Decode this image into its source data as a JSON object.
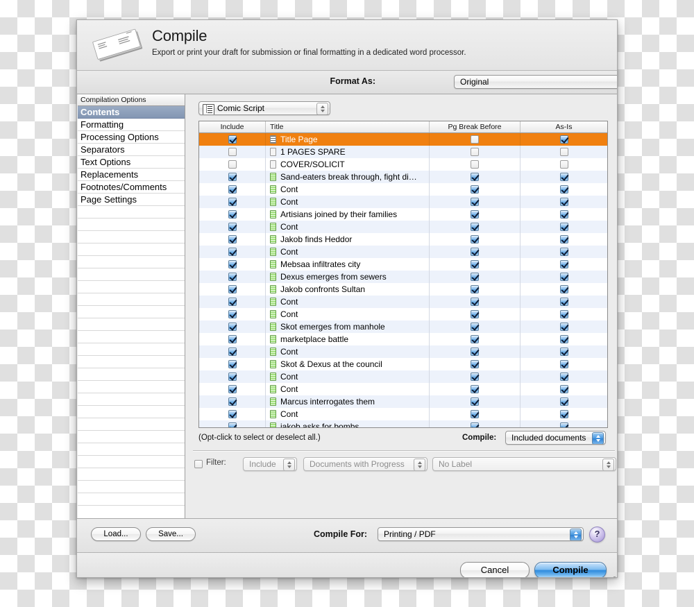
{
  "header": {
    "title": "Compile",
    "subtitle": "Export or print your draft for submission or final formatting in a dedicated word processor.",
    "icon": "manuscript-icon"
  },
  "format_bar": {
    "label": "Format As:",
    "value": "Original",
    "reveal_icon": "triangle-up-icon"
  },
  "sidebar": {
    "header": "Compilation Options",
    "items": [
      {
        "label": "Contents",
        "selected": true
      },
      {
        "label": "Formatting",
        "selected": false
      },
      {
        "label": "Processing Options",
        "selected": false
      },
      {
        "label": "Separators",
        "selected": false
      },
      {
        "label": "Text Options",
        "selected": false
      },
      {
        "label": "Replacements",
        "selected": false
      },
      {
        "label": "Footnotes/Comments",
        "selected": false
      },
      {
        "label": "Page Settings",
        "selected": false
      }
    ]
  },
  "script_popup": {
    "value": "Comic Script",
    "icon": "script-document-icon"
  },
  "table": {
    "columns": [
      "Include",
      "Title",
      "Pg Break Before",
      "As-Is"
    ],
    "rows": [
      {
        "include": true,
        "title": "Title Page",
        "icon": "title-page-icon",
        "pg_break": false,
        "as_is": true,
        "selected": true
      },
      {
        "include": false,
        "title": "1 PAGES SPARE",
        "icon": "plain-document-icon",
        "pg_break": false,
        "as_is": false,
        "selected": false
      },
      {
        "include": false,
        "title": "COVER/SOLICIT",
        "icon": "plain-document-icon",
        "pg_break": false,
        "as_is": false,
        "selected": false
      },
      {
        "include": true,
        "title": "Sand-eaters break through, fight di…",
        "icon": "text-document-icon",
        "pg_break": true,
        "as_is": true,
        "selected": false
      },
      {
        "include": true,
        "title": "Cont",
        "icon": "text-document-icon",
        "pg_break": true,
        "as_is": true,
        "selected": false
      },
      {
        "include": true,
        "title": "Cont",
        "icon": "text-document-icon",
        "pg_break": true,
        "as_is": true,
        "selected": false
      },
      {
        "include": true,
        "title": "Artisians joined by their families",
        "icon": "text-document-icon",
        "pg_break": true,
        "as_is": true,
        "selected": false
      },
      {
        "include": true,
        "title": "Cont",
        "icon": "text-document-icon",
        "pg_break": true,
        "as_is": true,
        "selected": false
      },
      {
        "include": true,
        "title": "Jakob finds Heddor",
        "icon": "text-document-icon",
        "pg_break": true,
        "as_is": true,
        "selected": false
      },
      {
        "include": true,
        "title": "Cont",
        "icon": "text-document-icon",
        "pg_break": true,
        "as_is": true,
        "selected": false
      },
      {
        "include": true,
        "title": "Mebsaa infiltrates city",
        "icon": "text-document-icon",
        "pg_break": true,
        "as_is": true,
        "selected": false
      },
      {
        "include": true,
        "title": "Dexus emerges from sewers",
        "icon": "text-document-icon",
        "pg_break": true,
        "as_is": true,
        "selected": false
      },
      {
        "include": true,
        "title": "Jakob confronts Sultan",
        "icon": "text-document-icon",
        "pg_break": true,
        "as_is": true,
        "selected": false
      },
      {
        "include": true,
        "title": "Cont",
        "icon": "text-document-icon",
        "pg_break": true,
        "as_is": true,
        "selected": false
      },
      {
        "include": true,
        "title": "Cont",
        "icon": "text-document-icon",
        "pg_break": true,
        "as_is": true,
        "selected": false
      },
      {
        "include": true,
        "title": "Skot emerges from manhole",
        "icon": "text-document-icon",
        "pg_break": true,
        "as_is": true,
        "selected": false
      },
      {
        "include": true,
        "title": "marketplace battle",
        "icon": "text-document-icon",
        "pg_break": true,
        "as_is": true,
        "selected": false
      },
      {
        "include": true,
        "title": "Cont",
        "icon": "text-document-icon",
        "pg_break": true,
        "as_is": true,
        "selected": false
      },
      {
        "include": true,
        "title": "Skot & Dexus at the council",
        "icon": "text-document-icon",
        "pg_break": true,
        "as_is": true,
        "selected": false
      },
      {
        "include": true,
        "title": "Cont",
        "icon": "text-document-icon",
        "pg_break": true,
        "as_is": true,
        "selected": false
      },
      {
        "include": true,
        "title": "Cont",
        "icon": "text-document-icon",
        "pg_break": true,
        "as_is": true,
        "selected": false
      },
      {
        "include": true,
        "title": "Marcus interrogates them",
        "icon": "text-document-icon",
        "pg_break": true,
        "as_is": true,
        "selected": false
      },
      {
        "include": true,
        "title": "Cont",
        "icon": "text-document-icon",
        "pg_break": true,
        "as_is": true,
        "selected": false
      },
      {
        "include": true,
        "title": "jakob asks for bombs",
        "icon": "text-document-icon",
        "pg_break": true,
        "as_is": true,
        "selected": false
      }
    ],
    "empty_row_count": 4
  },
  "under_table": {
    "hint": "(Opt-click to select or deselect all.)",
    "compile_label": "Compile:",
    "compile_scope": "Included documents"
  },
  "filter": {
    "checked": false,
    "label": "Filter:",
    "mode": "Include",
    "type": "Documents with Progress",
    "label_value": "No Label"
  },
  "bottom": {
    "load_label": "Load...",
    "save_label": "Save...",
    "compile_for_label": "Compile For:",
    "compile_for_value": "Printing / PDF",
    "help_glyph": "?",
    "cancel_label": "Cancel",
    "compile_label": "Compile"
  },
  "colors": {
    "selection_orange": "#f08010",
    "alt_row_blue": "#edf2fb",
    "sidebar_selected": "#8396b3",
    "accent_blue": "#2f8bdd",
    "doc_green": "#9fe07a"
  }
}
